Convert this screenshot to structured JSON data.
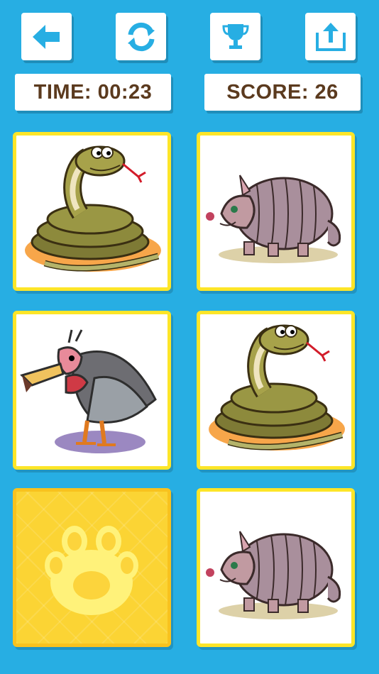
{
  "toolbar": {
    "back_icon": "arrow-left-icon",
    "restart_icon": "refresh-icon",
    "trophy_icon": "trophy-icon",
    "share_icon": "share-icon",
    "accent_color": "#27aee3"
  },
  "status": {
    "time_text": "TIME: 00:23",
    "score_text": "SCORE: 26"
  },
  "cards": [
    {
      "animal": "snake",
      "state": "face-up"
    },
    {
      "animal": "armadillo",
      "state": "face-up"
    },
    {
      "animal": "vulture",
      "state": "face-up"
    },
    {
      "animal": "snake",
      "state": "face-up"
    },
    {
      "animal": "paw",
      "state": "face-down"
    },
    {
      "animal": "armadillo",
      "state": "face-up"
    }
  ],
  "colors": {
    "background": "#27aee3",
    "card_border": "#fde528",
    "card_back": "#fbd434",
    "text": "#5b3a1e"
  }
}
